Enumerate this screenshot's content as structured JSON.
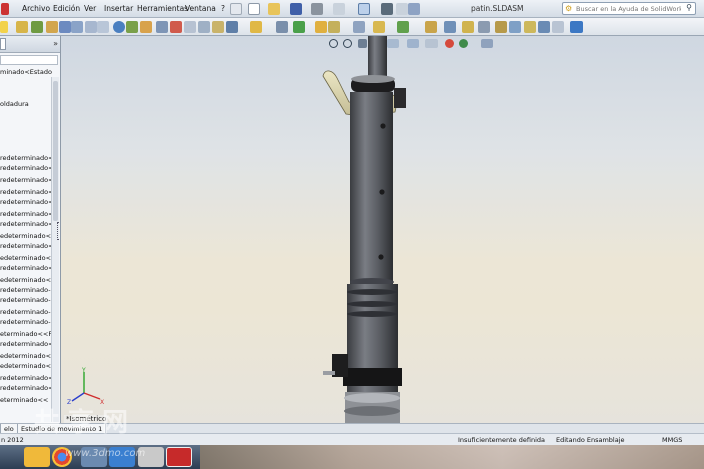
{
  "menu": {
    "items": [
      "Archivo",
      "Edición",
      "Ver",
      "Insertar",
      "Herramientas",
      "Ventana",
      "?"
    ],
    "doc_title": "patin.SLDASM",
    "help_placeholder": "Buscar en la Ayuda de SolidWorks"
  },
  "feature_tree": {
    "rows": [
      "minado<Estado",
      "",
      "oldadura",
      "",
      "",
      "redeterminado<",
      "redeterminado<",
      "redeterminado<",
      "redeterminado<|",
      "redeterminado<",
      "redeterminado<",
      "redeterminado<",
      "edeterminado<",
      "redeterminado<",
      "edeterminado<",
      "redeterminado<",
      "edeterminado<",
      "redeterminado-",
      "redeterminado-",
      "redeterminado-",
      "redeterminado-",
      "eterminado<<F",
      "redeterminado<",
      "edeterminado<",
      "edeterminado<",
      "redeterminado<",
      "redeterminado<",
      "eterminado<<"
    ]
  },
  "viewport": {
    "view_label": "*Isométrico"
  },
  "tabs": {
    "items": [
      "elo",
      "Estudio de movimiento 1"
    ]
  },
  "status": {
    "left": "n 2012",
    "definition": "Insuficientemente definida",
    "mode": "Editando Ensamblaje",
    "units": "MMGS"
  },
  "watermark": {
    "main": "共享网",
    "sub": "www.3dmo.com"
  },
  "colors": {
    "tube": "#5e6168",
    "clamp_arm": "#d9d3ae",
    "band": "#161616"
  }
}
